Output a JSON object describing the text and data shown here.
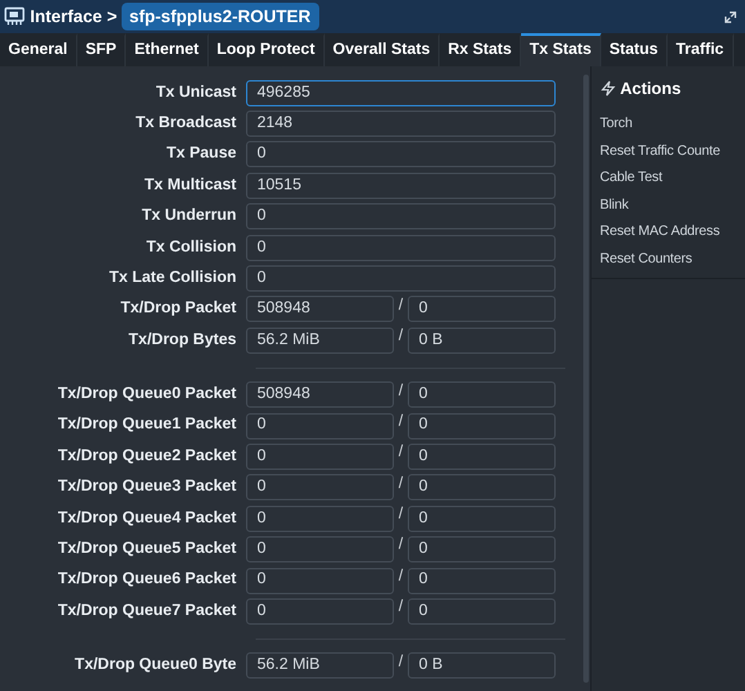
{
  "breadcrumb": {
    "section": "Interface >",
    "item": "sfp-sfpplus2-ROUTER"
  },
  "tabs": [
    {
      "label": "General",
      "selected": false
    },
    {
      "label": "SFP",
      "selected": false
    },
    {
      "label": "Ethernet",
      "selected": false
    },
    {
      "label": "Loop Protect",
      "selected": false
    },
    {
      "label": "Overall Stats",
      "selected": false
    },
    {
      "label": "Rx Stats",
      "selected": false
    },
    {
      "label": "Tx Stats",
      "selected": true
    },
    {
      "label": "Status",
      "selected": false
    },
    {
      "label": "Traffic",
      "selected": false
    }
  ],
  "groups": [
    {
      "rows": [
        {
          "label": "Tx Unicast",
          "kind": "single",
          "value": "496285",
          "focused": true
        },
        {
          "label": "Tx Broadcast",
          "kind": "single",
          "value": "2148",
          "focused": false
        },
        {
          "label": "Tx Pause",
          "kind": "single",
          "value": "0",
          "focused": false
        },
        {
          "label": "Tx Multicast",
          "kind": "single",
          "value": "10515",
          "focused": false
        },
        {
          "label": "Tx Underrun",
          "kind": "single",
          "value": "0",
          "focused": false
        },
        {
          "label": "Tx Collision",
          "kind": "single",
          "value": "0",
          "focused": false
        },
        {
          "label": "Tx Late Collision",
          "kind": "single",
          "value": "0",
          "focused": false
        },
        {
          "label": "Tx/Drop Packet",
          "kind": "pair",
          "value": "508948",
          "separator": "/",
          "value_2": "0",
          "focused": false
        },
        {
          "label": "Tx/Drop Bytes",
          "kind": "pair",
          "value": "56.2 MiB",
          "separator": "/",
          "value_2": "0 B",
          "focused": false
        }
      ]
    },
    {
      "rows": [
        {
          "label": "Tx/Drop Queue0 Packet",
          "kind": "pair",
          "value": "508948",
          "separator": "/",
          "value_2": "0",
          "focused": false
        },
        {
          "label": "Tx/Drop Queue1 Packet",
          "kind": "pair",
          "value": "0",
          "separator": "/",
          "value_2": "0",
          "focused": false
        },
        {
          "label": "Tx/Drop Queue2 Packet",
          "kind": "pair",
          "value": "0",
          "separator": "/",
          "value_2": "0",
          "focused": false
        },
        {
          "label": "Tx/Drop Queue3 Packet",
          "kind": "pair",
          "value": "0",
          "separator": "/",
          "value_2": "0",
          "focused": false
        },
        {
          "label": "Tx/Drop Queue4 Packet",
          "kind": "pair",
          "value": "0",
          "separator": "/",
          "value_2": "0",
          "focused": false
        },
        {
          "label": "Tx/Drop Queue5 Packet",
          "kind": "pair",
          "value": "0",
          "separator": "/",
          "value_2": "0",
          "focused": false
        },
        {
          "label": "Tx/Drop Queue6 Packet",
          "kind": "pair",
          "value": "0",
          "separator": "/",
          "value_2": "0",
          "focused": false
        },
        {
          "label": "Tx/Drop Queue7 Packet",
          "kind": "pair",
          "value": "0",
          "separator": "/",
          "value_2": "0",
          "focused": false
        }
      ]
    },
    {
      "rows": [
        {
          "label": "Tx/Drop Queue0 Byte",
          "kind": "pair",
          "value": "56.2 MiB",
          "separator": "/",
          "value_2": "0 B",
          "focused": false
        }
      ]
    }
  ],
  "actions": {
    "title": "Actions",
    "items": [
      "Torch",
      "Reset Traffic Counte",
      "Cable Test",
      "Blink",
      "Reset MAC Address",
      "Reset Counters"
    ]
  }
}
